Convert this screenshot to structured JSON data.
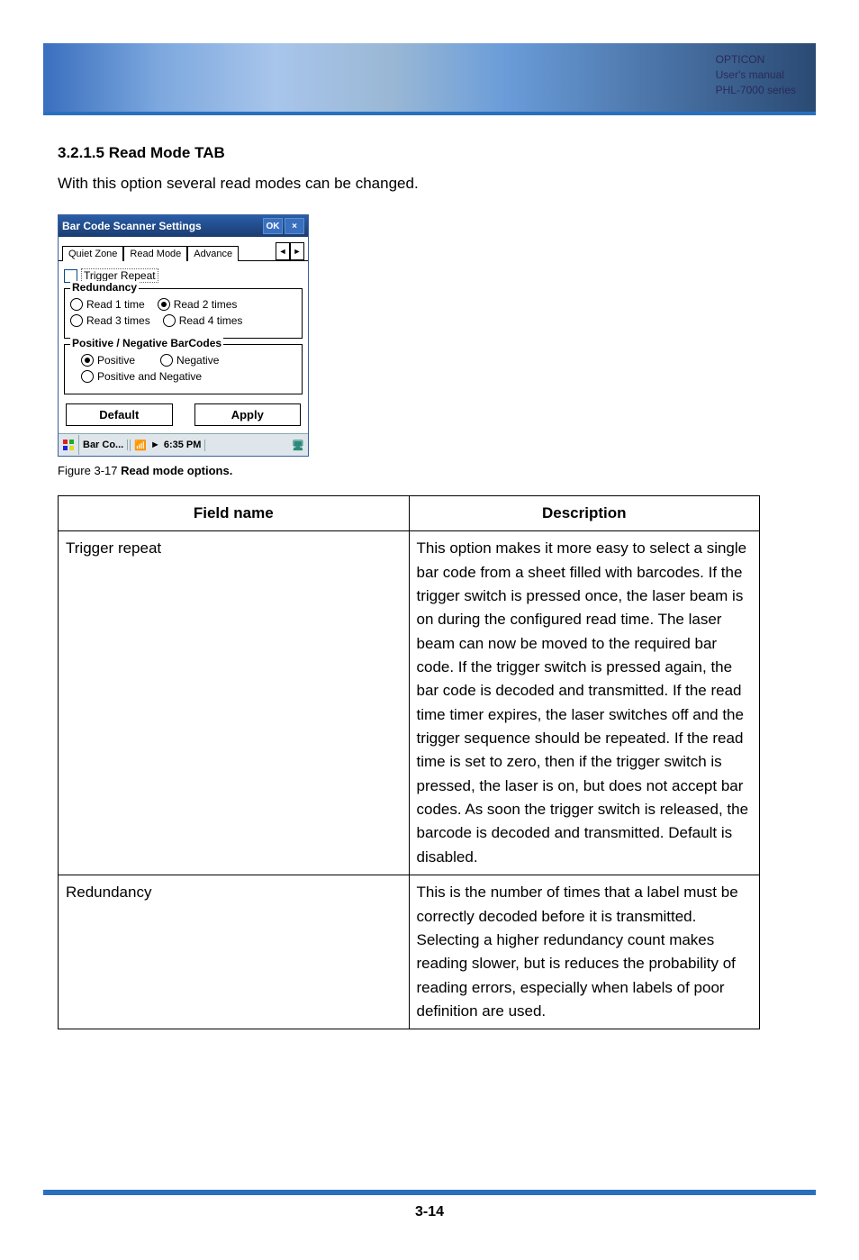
{
  "banner": {
    "brand": "OPTICON",
    "line2": "User's manual",
    "line3": "PHL-7000 series"
  },
  "heading": "3.2.1.5 Read Mode TAB",
  "intro": "With this option several read modes can be changed.",
  "screenshot": {
    "title": "Bar Code Scanner Settings",
    "ok": "OK",
    "close": "×",
    "tabs": {
      "t1": "Quiet Zone",
      "t2": "Read Mode",
      "t3": "Advance",
      "left": "◄",
      "right": "►"
    },
    "trigger_repeat": "Trigger Repeat",
    "redundancy": {
      "legend": "Redundancy",
      "r1": "Read 1 time",
      "r2": "Read 2 times",
      "r3": "Read 3 times",
      "r4": "Read 4 times"
    },
    "posneg": {
      "legend": "Positive / Negative BarCodes",
      "p": "Positive",
      "n": "Negative",
      "pn": "Positive and Negative"
    },
    "buttons": {
      "def": "Default",
      "apply": "Apply"
    },
    "taskbar": {
      "app": "Bar Co...",
      "time": "6:35 PM",
      "signal": "📶",
      "speaker": "►"
    }
  },
  "figure_caption_prefix": "Figure 3-17 ",
  "figure_caption_bold": "Read mode options.",
  "table": {
    "h1": "Field name",
    "h2": "Description",
    "r1_name": "Trigger repeat",
    "r1_desc": "This option makes it more easy to select a single bar code from a sheet filled with barcodes. If the trigger switch is pressed once, the laser beam is on during the configured read time. The laser beam can now be moved to the required bar code. If the trigger switch is pressed again, the bar code is decoded and transmitted. If the read time timer expires, the laser switches off and the trigger sequence should be repeated. If the read time is set to zero, then if the trigger switch is pressed, the laser is on, but does not accept bar codes. As soon the trigger switch is released, the barcode is decoded and transmitted. Default is disabled.",
    "r2_name": "Redundancy",
    "r2_desc": "This is the number of times that a label must be correctly decoded before it is transmitted. Selecting a higher redundancy count makes reading slower, but is reduces the probability of reading errors, especially when labels of poor definition are used."
  },
  "page_number": "3-14"
}
